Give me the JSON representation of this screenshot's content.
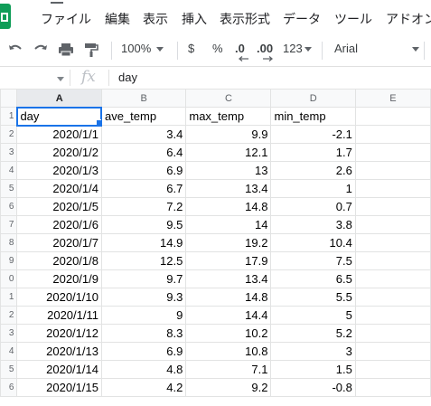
{
  "menu": {
    "items": [
      "ファイル",
      "編集",
      "表示",
      "挿入",
      "表示形式",
      "データ",
      "ツール",
      "アドオン"
    ]
  },
  "toolbar": {
    "zoom": "100%",
    "currency": "$",
    "percent": "%",
    "decrease_decimal": ".0",
    "increase_decimal": ".00",
    "more_formats": "123",
    "font": "Arial"
  },
  "formula_bar": {
    "fx": "fx",
    "content": "day"
  },
  "sheet": {
    "columns": [
      "A",
      "B",
      "C",
      "D",
      "E"
    ],
    "header_row": [
      "day",
      "ave_temp",
      "max_temp",
      "min_temp",
      ""
    ],
    "row_numbers": [
      "1",
      "2",
      "3",
      "4",
      "5",
      "6",
      "7",
      "8",
      "9",
      "0",
      "1",
      "2",
      "3",
      "4",
      "5",
      "6"
    ],
    "rows": [
      [
        "2020/1/1",
        "3.4",
        "9.9",
        "-2.1"
      ],
      [
        "2020/1/2",
        "6.4",
        "12.1",
        "1.7"
      ],
      [
        "2020/1/3",
        "6.9",
        "13",
        "2.6"
      ],
      [
        "2020/1/4",
        "6.7",
        "13.4",
        "1"
      ],
      [
        "2020/1/5",
        "7.2",
        "14.8",
        "0.7"
      ],
      [
        "2020/1/6",
        "9.5",
        "14",
        "3.8"
      ],
      [
        "2020/1/7",
        "14.9",
        "19.2",
        "10.4"
      ],
      [
        "2020/1/8",
        "12.5",
        "17.9",
        "7.5"
      ],
      [
        "2020/1/9",
        "9.7",
        "13.4",
        "6.5"
      ],
      [
        "2020/1/10",
        "9.3",
        "14.8",
        "5.5"
      ],
      [
        "2020/1/11",
        "9",
        "14.4",
        "5"
      ],
      [
        "2020/1/12",
        "8.3",
        "10.2",
        "5.2"
      ],
      [
        "2020/1/13",
        "6.9",
        "10.8",
        "3"
      ],
      [
        "2020/1/14",
        "4.8",
        "7.1",
        "1.5"
      ],
      [
        "2020/1/15",
        "4.2",
        "9.2",
        "-0.8"
      ]
    ]
  },
  "colors": {
    "accent": "#1a73e8",
    "brand": "#0f9d58",
    "header_bg": "#f8f9fa",
    "gridline": "#e2e3e3"
  }
}
